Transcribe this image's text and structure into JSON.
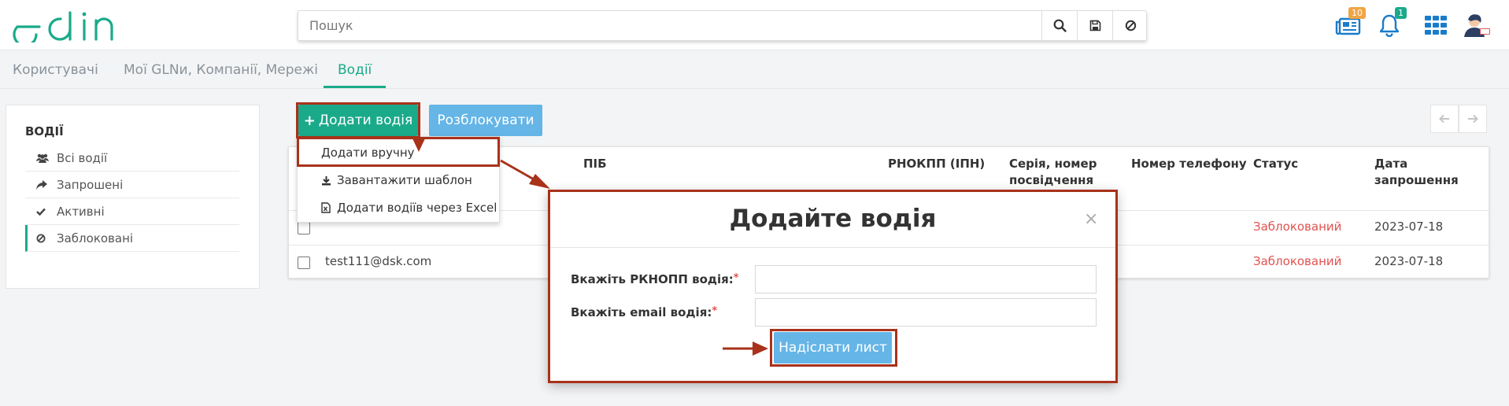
{
  "app": {
    "logo_text": "edin"
  },
  "search": {
    "placeholder": "Пошук"
  },
  "header": {
    "news_badge": "10",
    "notifications_badge": "1",
    "colors": {
      "news_badge": "#f0a545",
      "notifications_badge": "#1aaa8a",
      "icons": "#1a7cc9"
    }
  },
  "tabs": [
    {
      "label": "Користувачі"
    },
    {
      "label": "Мої GLNи, Компанії, Мережі"
    },
    {
      "label": "Водії"
    }
  ],
  "sidebar": {
    "title": "ВОДІЇ",
    "items": [
      {
        "label": "Всі водії",
        "icon": "users-icon"
      },
      {
        "label": "Запрошені",
        "icon": "share-icon"
      },
      {
        "label": "Активні",
        "icon": "check-icon"
      },
      {
        "label": "Заблоковані",
        "icon": "ban-icon"
      }
    ]
  },
  "toolbar": {
    "add_label": "Додати водія",
    "unlock_label": "Розблокувати"
  },
  "dropdown": {
    "items": [
      {
        "label": "Додати вручну"
      },
      {
        "label": "Завантажити шаблон",
        "icon": "download-icon"
      },
      {
        "label": "Додати водіїв через Excel",
        "icon": "excel-file-icon"
      }
    ]
  },
  "table": {
    "columns": {
      "name": "ПІБ",
      "tax_id": "РНОКПП (ІПН)",
      "doc_line1": "Серія, номер",
      "doc_line2": "посвідчення",
      "phone": "Номер телефону",
      "status": "Статус",
      "date": "Дата запрошення"
    },
    "rows": [
      {
        "email": "",
        "status": "Заблокований",
        "date": "2023-07-18"
      },
      {
        "email": "test111@dsk.com",
        "status": "Заблокований",
        "date": "2023-07-18"
      }
    ]
  },
  "modal": {
    "title": "Додайте водія",
    "close": "×",
    "tax_label": "Вкажіть РКНОПП водія:",
    "email_label": "Вкажіть email водія:",
    "required_mark": "*",
    "send_label": "Надіслати лист"
  },
  "colors": {
    "accent": "#1aaa8a",
    "secondary_button": "#65b5e6",
    "status_blocked": "#e0534f",
    "annotation": "#a8321a"
  }
}
